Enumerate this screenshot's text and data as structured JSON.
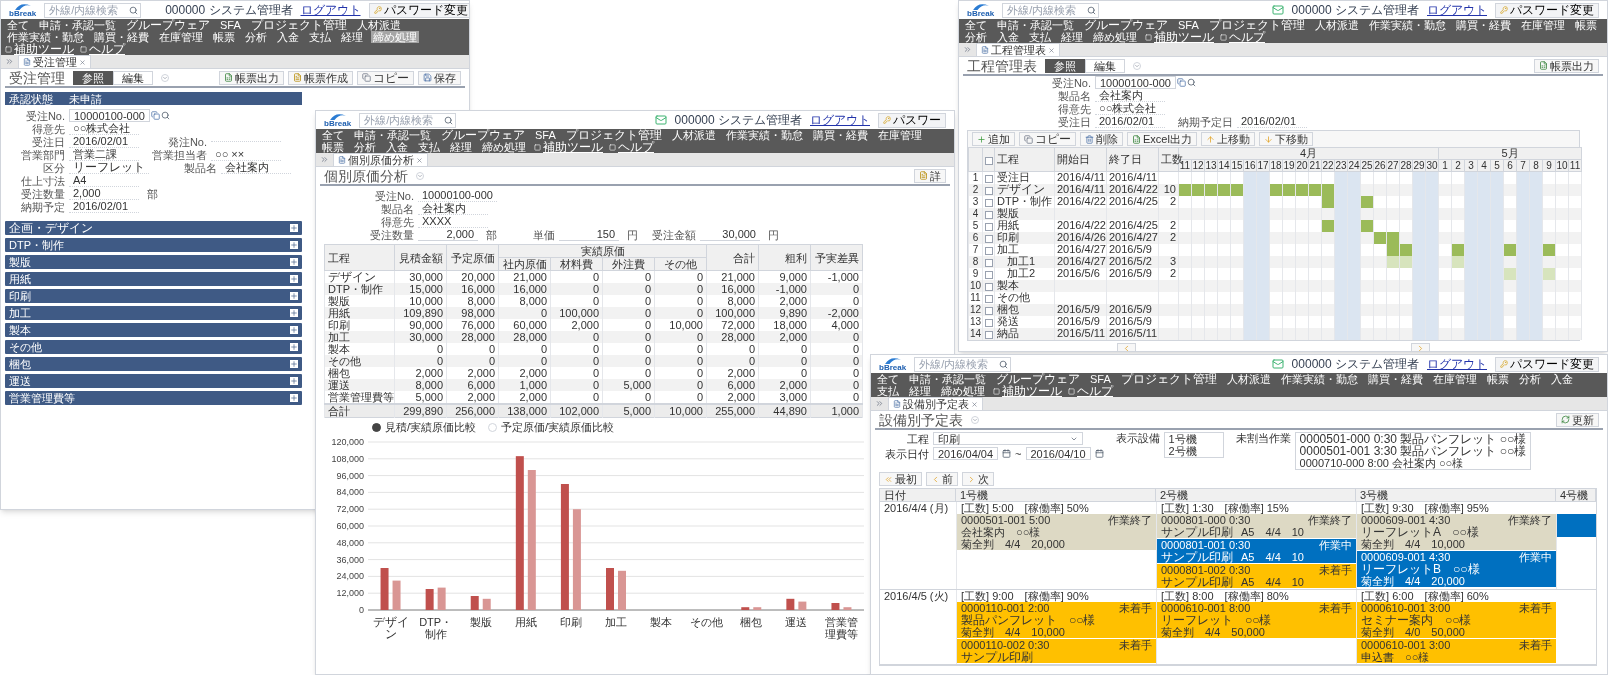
{
  "windows": [
    {
      "kind": "order",
      "header": {
        "logo": "bBreak",
        "search_placeholder": "外線/内線検索",
        "user": "000000 システム管理者",
        "logout": "ログアウト",
        "password_button": "パスワード変更"
      },
      "nav": [
        {
          "label": "全て",
          "selected": false
        },
        {
          "label": "申請・承認一覧",
          "selected": false
        },
        {
          "label": "グループウェア",
          "selected": false
        },
        {
          "label": "SFA",
          "selected": false
        },
        {
          "label": "プロジェクト管理",
          "selected": false
        },
        {
          "label": "人材派遣",
          "selected": false
        },
        {
          "label": "作業実績・勤怠",
          "selected": false
        },
        {
          "label": "購買・経費",
          "selected": false
        },
        {
          "label": "在庫管理",
          "selected": false
        },
        {
          "label": "帳票",
          "selected": false
        },
        {
          "label": "分析",
          "selected": false
        },
        {
          "label": "入金",
          "selected": false
        },
        {
          "label": "支払",
          "selected": false
        },
        {
          "label": "経理",
          "selected": false
        },
        {
          "label": "締め処理",
          "selected": true
        }
      ],
      "nav_tools": [
        "補助ツール",
        "ヘルプ"
      ],
      "tab": "受注管理",
      "title": "受注管理",
      "modes": [
        {
          "label": "参照",
          "selected": true
        },
        {
          "label": "編集",
          "selected": false
        }
      ],
      "title_buttons": [
        {
          "label": "帳票出力",
          "kind": "excel"
        },
        {
          "label": "帳票作成",
          "kind": "document"
        },
        {
          "label": "コピー",
          "kind": "copy"
        },
        {
          "label": "保存",
          "kind": "save"
        }
      ],
      "approval": {
        "label": "承認状態",
        "value": "未申請"
      },
      "field_rows": [
        [
          {
            "label": "受注No.",
            "value": "10000100-000",
            "kind": "lookup"
          }
        ],
        [
          {
            "label": "得意先",
            "value": "○○株式会社",
            "kind": "text"
          }
        ],
        [
          {
            "label": "受注日",
            "value": "2016/02/01",
            "kind": "text"
          },
          {
            "label": "発注No.",
            "kind": "text"
          }
        ],
        [
          {
            "label": "営業部門",
            "value": "営業二課",
            "kind": "text"
          },
          {
            "label": "営業担当者",
            "value": "○○ ××",
            "kind": "text"
          }
        ],
        [
          {
            "label": "区分",
            "value": "リーフレット",
            "kind": "text"
          },
          {
            "label": "製品名",
            "value": "会社案内",
            "kind": "text"
          }
        ],
        [
          {
            "label": "仕上寸法",
            "value": "A4",
            "kind": "text"
          }
        ],
        [
          {
            "label": "受注数量",
            "value": "2,000",
            "unit": "部",
            "kind": "text"
          }
        ],
        [
          {
            "label": "納期予定",
            "value": "2016/02/01",
            "kind": "text"
          }
        ]
      ],
      "sections": [
        "企画・デザイン",
        "DTP・制作",
        "製版",
        "用紙",
        "印刷",
        "加工",
        "製本",
        "その他",
        "梱包",
        "運送",
        "営業管理費等"
      ]
    },
    {
      "kind": "gantt",
      "header": {
        "logo": "bBreak",
        "search_placeholder": "外線/内線検索",
        "user": "000000 システム管理者",
        "logout": "ログアウト",
        "password_button": "パスワード変更"
      },
      "nav": [
        {
          "label": "全て",
          "selected": false
        },
        {
          "label": "申請・承認一覧",
          "selected": false
        },
        {
          "label": "グループウェア",
          "selected": false
        },
        {
          "label": "SFA",
          "selected": false
        },
        {
          "label": "プロジェクト管理",
          "selected": false
        },
        {
          "label": "人材派遣",
          "selected": false
        },
        {
          "label": "作業実績・勤怠",
          "selected": false
        },
        {
          "label": "購買・経費",
          "selected": false
        },
        {
          "label": "在庫管理",
          "selected": false
        },
        {
          "label": "帳票",
          "selected": false
        },
        {
          "label": "分析",
          "selected": false
        },
        {
          "label": "入金",
          "selected": false
        },
        {
          "label": "支払",
          "selected": false
        },
        {
          "label": "経理",
          "selected": false
        },
        {
          "label": "締め処理",
          "selected": false
        }
      ],
      "nav_tools": [
        "補助ツール",
        "ヘルプ"
      ],
      "tab": "工程管理表",
      "title": "工程管理表",
      "modes": [
        {
          "label": "参照",
          "selected": true
        },
        {
          "label": "編集",
          "selected": false
        }
      ],
      "title_buttons": [
        {
          "label": "帳票出力",
          "kind": "excel"
        }
      ],
      "field_rows": [
        [
          {
            "label": "受注No.",
            "value": "10000100-000",
            "kind": "lookup"
          }
        ],
        [
          {
            "label": "製品名",
            "value": "会社案内",
            "kind": "text"
          }
        ],
        [
          {
            "label": "得意先",
            "value": "○○株式会社",
            "kind": "text"
          }
        ],
        [
          {
            "label": "受注日",
            "value": "2016/02/01",
            "kind": "text"
          },
          {
            "label": "納期予定日",
            "value": "2016/02/01",
            "kind": "text"
          }
        ]
      ],
      "toolbar": [
        {
          "label": "追加",
          "kind": "add"
        },
        {
          "label": "コピー",
          "kind": "copy"
        },
        {
          "label": "削除",
          "kind": "delete"
        },
        {
          "label": "Excel出力",
          "kind": "excel"
        },
        {
          "label": "上移動",
          "kind": "up"
        },
        {
          "label": "下移動",
          "kind": "down"
        }
      ],
      "gantt": {
        "all_checked": false,
        "columns": [
          "工程",
          "開始日",
          "終了日",
          "工数"
        ],
        "months": [
          {
            "label": "4月",
            "days": [
              {
                "label": "11",
                "holiday": false
              },
              {
                "label": "12",
                "holiday": false
              },
              {
                "label": "13",
                "holiday": false
              },
              {
                "label": "14",
                "holiday": false
              },
              {
                "label": "15",
                "holiday": false
              },
              {
                "label": "16",
                "holiday": true
              },
              {
                "label": "17",
                "holiday": true
              },
              {
                "label": "18",
                "holiday": false
              },
              {
                "label": "19",
                "holiday": false
              },
              {
                "label": "20",
                "holiday": false
              },
              {
                "label": "21",
                "holiday": false
              },
              {
                "label": "22",
                "holiday": false
              },
              {
                "label": "23",
                "holiday": true
              },
              {
                "label": "24",
                "holiday": true
              },
              {
                "label": "25",
                "holiday": false
              },
              {
                "label": "26",
                "holiday": false
              },
              {
                "label": "27",
                "holiday": false
              },
              {
                "label": "28",
                "holiday": false
              },
              {
                "label": "29",
                "holiday": true
              },
              {
                "label": "30",
                "holiday": true
              }
            ]
          },
          {
            "label": "5月",
            "days": [
              {
                "label": "1",
                "holiday": false
              },
              {
                "label": "2",
                "holiday": false
              },
              {
                "label": "3",
                "holiday": true
              },
              {
                "label": "4",
                "holiday": true
              },
              {
                "label": "5",
                "holiday": true
              },
              {
                "label": "6",
                "holiday": false
              },
              {
                "label": "7",
                "holiday": true
              },
              {
                "label": "8",
                "holiday": true
              },
              {
                "label": "9",
                "holiday": false
              },
              {
                "label": "10",
                "holiday": false
              },
              {
                "label": "11",
                "holiday": false
              }
            ]
          }
        ],
        "rows": [
          {
            "no": "1",
            "checked": false,
            "name": "受注日",
            "start": "2016/4/11",
            "end": "2016/4/11",
            "scheduled": [
              false,
              false,
              false,
              false,
              false,
              false,
              false,
              false,
              false,
              false,
              false,
              false,
              false,
              false,
              false,
              false,
              false,
              false,
              false,
              false,
              false,
              false,
              false,
              false,
              false,
              false,
              false,
              false,
              false,
              false,
              false
            ]
          },
          {
            "no": "2",
            "checked": false,
            "name": "デザイン",
            "start": "2016/4/11",
            "end": "2016/4/22",
            "hours": "10",
            "scheduled": [
              true,
              true,
              true,
              true,
              true,
              false,
              false,
              true,
              true,
              true,
              true,
              true,
              false,
              false,
              false,
              false,
              false,
              false,
              false,
              false,
              false,
              false,
              false,
              false,
              false,
              false,
              false,
              false,
              false,
              false,
              false
            ]
          },
          {
            "no": "3",
            "checked": false,
            "name": "DTP・制作",
            "start": "2016/4/22",
            "end": "2016/4/25",
            "hours": "2",
            "scheduled": [
              false,
              false,
              false,
              false,
              false,
              false,
              false,
              false,
              false,
              false,
              false,
              true,
              false,
              false,
              true,
              false,
              false,
              false,
              false,
              false,
              false,
              false,
              false,
              false,
              false,
              false,
              false,
              false,
              false,
              false,
              false
            ]
          },
          {
            "no": "4",
            "checked": false,
            "name": "製版",
            "scheduled": [
              false,
              false,
              false,
              false,
              false,
              false,
              false,
              false,
              false,
              false,
              false,
              false,
              false,
              false,
              false,
              false,
              false,
              false,
              false,
              false,
              false,
              false,
              false,
              false,
              false,
              false,
              false,
              false,
              false,
              false,
              false
            ]
          },
          {
            "no": "5",
            "checked": false,
            "name": "用紙",
            "start": "2016/4/22",
            "end": "2016/4/25",
            "hours": "2",
            "scheduled": [
              false,
              false,
              false,
              false,
              false,
              false,
              false,
              false,
              false,
              false,
              false,
              true,
              false,
              false,
              true,
              false,
              false,
              false,
              false,
              false,
              false,
              false,
              false,
              false,
              false,
              false,
              false,
              false,
              false,
              false,
              false
            ]
          },
          {
            "no": "6",
            "checked": false,
            "name": "印刷",
            "start": "2016/4/26",
            "end": "2016/4/27",
            "hours": "2",
            "scheduled": [
              false,
              false,
              false,
              false,
              false,
              false,
              false,
              false,
              false,
              false,
              false,
              false,
              false,
              false,
              false,
              true,
              true,
              false,
              false,
              false,
              false,
              false,
              false,
              false,
              false,
              false,
              false,
              false,
              false,
              false,
              false
            ]
          },
          {
            "no": "7",
            "checked": false,
            "name": "加工",
            "start": "2016/4/27",
            "end": "2016/5/9",
            "scheduled": [
              false,
              false,
              false,
              false,
              false,
              false,
              false,
              false,
              false,
              false,
              false,
              false,
              false,
              false,
              false,
              false,
              true,
              true,
              false,
              false,
              false,
              true,
              false,
              false,
              false,
              true,
              false,
              false,
              true,
              false,
              false
            ],
            "children": [
              {
                "no": "8",
                "checked": false,
                "name": "加工1",
                "start": "2016/4/27",
                "end": "2016/5/2",
                "hours": "3",
                "scheduled": [
                  false,
                  false,
                  false,
                  false,
                  false,
                  false,
                  false,
                  false,
                  false,
                  false,
                  false,
                  false,
                  false,
                  false,
                  false,
                  false,
                  true,
                  true,
                  false,
                  false,
                  false,
                  true,
                  false,
                  false,
                  false,
                  false,
                  false,
                  false,
                  false,
                  false,
                  false
                ]
              },
              {
                "no": "9",
                "checked": false,
                "name": "加工2",
                "start": "2016/5/6",
                "end": "2016/5/9",
                "hours": "2",
                "scheduled": [
                  false,
                  false,
                  false,
                  false,
                  false,
                  false,
                  false,
                  false,
                  false,
                  false,
                  false,
                  false,
                  false,
                  false,
                  false,
                  false,
                  false,
                  false,
                  false,
                  false,
                  false,
                  false,
                  false,
                  false,
                  false,
                  true,
                  false,
                  false,
                  true,
                  false,
                  false
                ]
              }
            ]
          },
          {
            "no": "10",
            "checked": false,
            "name": "製本",
            "scheduled": [
              false,
              false,
              false,
              false,
              false,
              false,
              false,
              false,
              false,
              false,
              false,
              false,
              false,
              false,
              false,
              false,
              false,
              false,
              false,
              false,
              false,
              false,
              false,
              false,
              false,
              false,
              false,
              false,
              false,
              false,
              false
            ]
          },
          {
            "no": "11",
            "checked": false,
            "name": "その他",
            "scheduled": [
              false,
              false,
              false,
              false,
              false,
              false,
              false,
              false,
              false,
              false,
              false,
              false,
              false,
              false,
              false,
              false,
              false,
              false,
              false,
              false,
              false,
              false,
              false,
              false,
              false,
              false,
              false,
              false,
              false,
              false,
              false
            ]
          },
          {
            "no": "12",
            "checked": false,
            "name": "梱包",
            "start": "2016/5/9",
            "end": "2016/5/9",
            "scheduled": [
              false,
              false,
              false,
              false,
              false,
              false,
              false,
              false,
              false,
              false,
              false,
              false,
              false,
              false,
              false,
              false,
              false,
              false,
              false,
              false,
              false,
              false,
              false,
              false,
              false,
              false,
              false,
              false,
              false,
              false,
              false
            ]
          },
          {
            "no": "13",
            "checked": false,
            "name": "発送",
            "start": "2016/5/9",
            "end": "2016/5/9",
            "scheduled": [
              false,
              false,
              false,
              false,
              false,
              false,
              false,
              false,
              false,
              false,
              false,
              false,
              false,
              false,
              false,
              false,
              false,
              false,
              false,
              false,
              false,
              false,
              false,
              false,
              false,
              false,
              false,
              false,
              false,
              false,
              false
            ]
          },
          {
            "no": "14",
            "checked": false,
            "name": "納品",
            "start": "2016/5/11",
            "end": "2016/5/11",
            "scheduled": [
              false,
              false,
              false,
              false,
              false,
              false,
              false,
              false,
              false,
              false,
              false,
              false,
              false,
              false,
              false,
              false,
              false,
              false,
              false,
              false,
              false,
              false,
              false,
              false,
              false,
              false,
              false,
              false,
              false,
              false,
              false
            ]
          }
        ]
      }
    },
    {
      "kind": "cost",
      "header": {
        "logo": "bBreak",
        "search_placeholder": "外線/内線検索",
        "user": "000000 システム管理者",
        "logout": "ログアウト",
        "password_button": "パスワー"
      },
      "nav": [
        {
          "label": "全て",
          "selected": false
        },
        {
          "label": "申請・承認一覧",
          "selected": false
        },
        {
          "label": "グループウェア",
          "selected": false
        },
        {
          "label": "SFA",
          "selected": false
        },
        {
          "label": "プロジェクト管理",
          "selected": false
        },
        {
          "label": "人材派遣",
          "selected": false
        },
        {
          "label": "作業実績・勤怠",
          "selected": false
        },
        {
          "label": "購買・経費",
          "selected": false
        },
        {
          "label": "在庫管理",
          "selected": false
        },
        {
          "label": "帳票",
          "selected": false
        },
        {
          "label": "分析",
          "selected": false
        },
        {
          "label": "入金",
          "selected": false
        },
        {
          "label": "支払",
          "selected": false
        },
        {
          "label": "経理",
          "selected": false
        },
        {
          "label": "締め処理",
          "selected": false
        }
      ],
      "nav_tools": [
        "補助ツール",
        "ヘルプ"
      ],
      "tab": "個別原価分析",
      "title": "個別原価分析",
      "title_buttons": [
        {
          "label": "詳",
          "kind": "document"
        }
      ],
      "field_rows": [
        [
          {
            "label": "受注No.",
            "value": "10000100-000",
            "kind": "text"
          }
        ],
        [
          {
            "label": "製品名",
            "value": "会社案内",
            "kind": "text"
          }
        ],
        [
          {
            "label": "得意先",
            "value": "XXXX",
            "kind": "text"
          }
        ],
        [
          {
            "label": "受注数量",
            "value": "2,000",
            "unit": "部",
            "kind": "number"
          },
          {
            "label": "単価",
            "value": "150",
            "unit": "円",
            "kind": "number"
          },
          {
            "label": "受注金額",
            "value": "30,000",
            "unit": "円",
            "kind": "number"
          }
        ]
      ],
      "table": {
        "header_rows": [
          [
            {
              "label": "工程",
              "rowspan": 2
            },
            {
              "label": "見積金額",
              "rowspan": 2
            },
            {
              "label": "予定原価",
              "rowspan": 2
            },
            {
              "label": "実績原価",
              "colspan": 4
            },
            {
              "label": "合計",
              "rowspan": 2
            },
            {
              "label": "粗利",
              "rowspan": 2
            },
            {
              "label": "予実差異",
              "rowspan": 2
            }
          ],
          [
            {
              "label": "社内原価"
            },
            {
              "label": "材料費"
            },
            {
              "label": "外注費"
            },
            {
              "label": "その他"
            }
          ]
        ],
        "rows": [
          [
            "デザイン",
            "30,000",
            "20,000",
            "21,000",
            "0",
            "0",
            "0",
            "21,000",
            "9,000",
            "-1,000"
          ],
          [
            "DTP・制作",
            "15,000",
            "16,000",
            "16,000",
            "0",
            "0",
            "0",
            "16,000",
            "-1,000",
            "0"
          ],
          [
            "製版",
            "10,000",
            "8,000",
            "8,000",
            "0",
            "0",
            "0",
            "8,000",
            "2,000",
            "0"
          ],
          [
            "用紙",
            "109,890",
            "98,000",
            "0",
            "100,000",
            "0",
            "0",
            "100,000",
            "9,890",
            "-2,000"
          ],
          [
            "印刷",
            "90,000",
            "76,000",
            "60,000",
            "2,000",
            "0",
            "10,000",
            "72,000",
            "18,000",
            "4,000"
          ],
          [
            "加工",
            "30,000",
            "28,000",
            "28,000",
            "0",
            "0",
            "0",
            "28,000",
            "2,000",
            "0"
          ],
          [
            "製本",
            "0",
            "0",
            "0",
            "0",
            "0",
            "0",
            "0",
            "0",
            "0"
          ],
          [
            "その他",
            "0",
            "0",
            "0",
            "0",
            "0",
            "0",
            "0",
            "0",
            "0"
          ],
          [
            "梱包",
            "2,000",
            "2,000",
            "2,000",
            "0",
            "0",
            "0",
            "2,000",
            "0",
            "0"
          ],
          [
            "運送",
            "8,000",
            "6,000",
            "1,000",
            "0",
            "5,000",
            "0",
            "6,000",
            "2,000",
            "0"
          ],
          [
            "営業管理費等",
            "5,000",
            "2,000",
            "2,000",
            "0",
            "0",
            "0",
            "2,000",
            "3,000",
            "0"
          ]
        ],
        "total": [
          "合計",
          "299,890",
          "256,000",
          "138,000",
          "102,000",
          "5,000",
          "10,000",
          "255,000",
          "44,890",
          "1,000"
        ]
      },
      "chart_options": [
        {
          "label": "見積/実績原価比較",
          "selected": true
        },
        {
          "label": "予定原価/実績原価比較",
          "selected": false
        }
      ],
      "chart_data": {
        "type": "bar",
        "grid": true,
        "categories": [
          "デザイン",
          "DTP・制作",
          "製版",
          "用紙",
          "印刷",
          "加工",
          "製本",
          "その他",
          "梱包",
          "運送",
          "営業管理費等"
        ],
        "ylim": [
          0,
          120000
        ],
        "yticks": [
          {
            "value": 0,
            "label": "0"
          },
          {
            "value": 12000,
            "label": "12,000"
          },
          {
            "value": 24000,
            "label": "24,000"
          },
          {
            "value": 36000,
            "label": "36,000"
          },
          {
            "value": 48000,
            "label": "48,000"
          },
          {
            "value": 60000,
            "label": "60,000"
          },
          {
            "value": 72000,
            "label": "72,000"
          },
          {
            "value": 84000,
            "label": "84,000"
          },
          {
            "value": 96000,
            "label": "96,000"
          },
          {
            "value": 108000,
            "label": "108,000"
          },
          {
            "value": 120000,
            "label": "120,000"
          }
        ],
        "series": [
          {
            "color": "#c0504d",
            "values": [
              30000,
              15000,
              10000,
              109890,
              90000,
              30000,
              0,
              0,
              2000,
              8000,
              5000
            ]
          },
          {
            "color": "#d99694",
            "values": [
              21000,
              16000,
              8000,
              100000,
              72000,
              28000,
              0,
              0,
              2000,
              6000,
              2000
            ]
          }
        ]
      }
    },
    {
      "kind": "equipment",
      "header": {
        "logo": "bBreak",
        "search_placeholder": "外線/内線検索",
        "user": "000000 システム管理者",
        "logout": "ログアウト",
        "password_button": "パスワード変更"
      },
      "nav": [
        {
          "label": "全て",
          "selected": false
        },
        {
          "label": "申請・承認一覧",
          "selected": false
        },
        {
          "label": "グループウェア",
          "selected": false
        },
        {
          "label": "SFA",
          "selected": false
        },
        {
          "label": "プロジェクト管理",
          "selected": false
        },
        {
          "label": "人材派遣",
          "selected": false
        },
        {
          "label": "作業実績・勤怠",
          "selected": false
        },
        {
          "label": "購買・経費",
          "selected": false
        },
        {
          "label": "在庫管理",
          "selected": false
        },
        {
          "label": "帳票",
          "selected": false
        },
        {
          "label": "分析",
          "selected": false
        },
        {
          "label": "入金",
          "selected": false
        },
        {
          "label": "支払",
          "selected": false
        },
        {
          "label": "経理",
          "selected": false
        },
        {
          "label": "締め処理",
          "selected": false
        }
      ],
      "nav_tools": [
        "補助ツール",
        "ヘルプ"
      ],
      "tab": "設備別予定表",
      "title": "設備別予定表",
      "title_buttons": [
        {
          "label": "更新",
          "kind": "refresh"
        }
      ],
      "filters": {
        "process": {
          "label": "工程",
          "value": "印刷"
        },
        "dates": {
          "label": "表示日付",
          "from": "2016/04/04",
          "separator": "~",
          "to": "2016/04/10"
        },
        "machines": {
          "label": "表示設備",
          "items": [
            "1号機",
            "2号機"
          ]
        },
        "unassigned": {
          "label": "未割当作業",
          "items": [
            "0000501-000 0:30 製品パンフレット ○○様",
            "0000501-001 3:30 製品パンフレット ○○様",
            "0000710-000 8:00 会社案内 ○○様"
          ]
        }
      },
      "toolbar": [
        {
          "label": "最初",
          "kind": "first"
        },
        {
          "label": "前",
          "kind": "prev"
        },
        {
          "label": "次",
          "kind": "next"
        }
      ],
      "schedule": {
        "columns": [
          "日付",
          "1号機",
          "2号機",
          "3号機",
          "4号機"
        ],
        "days": [
          {
            "date": "2016/4/4 (月)",
            "machines": [
              {
                "summary": "[工数] 5:00　[稼働率] 50%",
                "jobs": [
                  {
                    "kind": "done",
                    "code": "0000501-001 5:00",
                    "status": "作業終了",
                    "lines": [
                      "会社案内　○○様",
                      "菊全判　4/4　20,000"
                    ]
                  }
                ]
              },
              {
                "summary": "[工数] 1:30　[稼働率] 15%",
                "jobs": [
                  {
                    "kind": "done",
                    "code": "0000801-000 0:30",
                    "status": "作業終了",
                    "lines": [
                      "サンプル印刷",
                      "A5　4/4　10"
                    ]
                  },
                  {
                    "kind": "in_progress",
                    "code": "0000801-001 0:30",
                    "status": "作業中",
                    "lines": [
                      "サンプル印刷",
                      "A5　4/4　10"
                    ]
                  },
                  {
                    "kind": "not_started",
                    "code": "0000801-002 0:30",
                    "status": "未着手",
                    "lines": [
                      "サンプル印刷",
                      "A5　4/4　10"
                    ]
                  }
                ]
              },
              {
                "summary": "[工数] 9:30　[稼働率] 95%",
                "jobs": [
                  {
                    "kind": "done",
                    "code": "0000609-001 4:30",
                    "status": "作業終了",
                    "lines": [
                      "リーフレットA　○○様",
                      "菊全判　4/4　10,000"
                    ]
                  },
                  {
                    "kind": "in_progress",
                    "code": "0000609-001 4:30",
                    "status": "作業中",
                    "lines": [
                      "リーフレットB　○○様",
                      "菊全判　4/4　20,000"
                    ]
                  }
                ]
              },
              {
                "jobs": [
                  {
                    "kind": "in_progress"
                  }
                ]
              }
            ]
          },
          {
            "date": "2016/4/5 (火)",
            "machines": [
              {
                "summary": "[工数] 9:00　[稼働率] 90%",
                "jobs": [
                  {
                    "kind": "not_started",
                    "code": "0000110-001 2:00",
                    "status": "未着手",
                    "lines": [
                      "製品パンフレット　○○様",
                      "菊全判　4/4　10,000"
                    ]
                  },
                  {
                    "kind": "not_started",
                    "code": "0000110-002 0:30",
                    "status": "未着手",
                    "lines": [
                      "サンプル印刷"
                    ]
                  }
                ]
              },
              {
                "summary": "[工数] 8:00　[稼働率] 80%",
                "jobs": [
                  {
                    "kind": "not_started",
                    "code": "0000610-001 8:00",
                    "status": "未着手",
                    "lines": [
                      "リーフレット　○○様",
                      "菊全判　4/4　50,000"
                    ]
                  }
                ]
              },
              {
                "summary": "[工数] 6:00　[稼働率] 60%",
                "jobs": [
                  {
                    "kind": "not_started",
                    "code": "0000610-001 3:00",
                    "status": "未着手",
                    "lines": [
                      "セミナー案内　○○様",
                      "菊全判　4/0　50,000"
                    ]
                  },
                  {
                    "kind": "not_started",
                    "code": "0000610-001 3:00",
                    "status": "未着手",
                    "lines": [
                      "申込書　○○様"
                    ]
                  }
                ]
              }
            ]
          }
        ]
      }
    }
  ]
}
